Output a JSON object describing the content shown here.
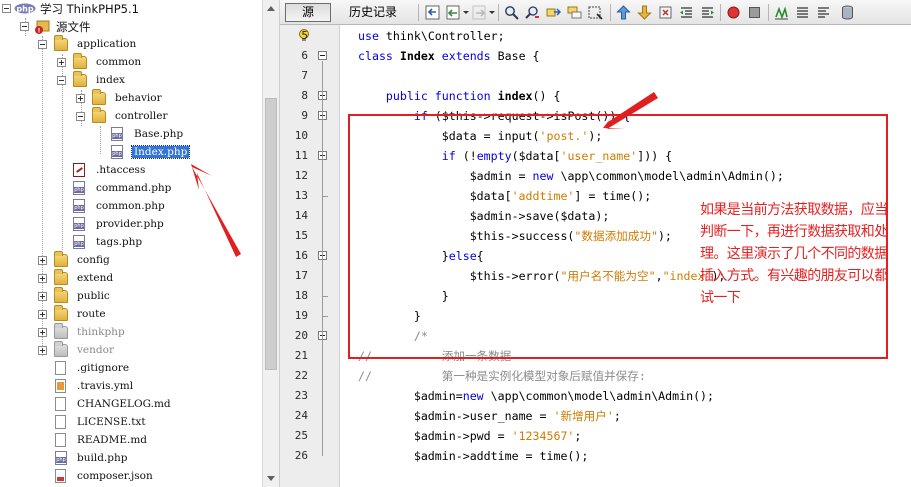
{
  "tree": {
    "root": "学习 ThinkPHP5.1",
    "source": "源文件",
    "items": {
      "application": "application",
      "common": "common",
      "index": "index",
      "behavior": "behavior",
      "controller": "controller",
      "base_php": "Base.php",
      "index_php": "Index.php",
      "htaccess": ".htaccess",
      "command_php": "command.php",
      "common_php": "common.php",
      "provider_php": "provider.php",
      "tags_php": "tags.php",
      "config": "config",
      "extend": "extend",
      "public": "public",
      "route": "route",
      "thinkphp": "thinkphp",
      "vendor": "vendor",
      "gitignore": ".gitignore",
      "travis": ".travis.yml",
      "changelog": "CHANGELOG.md",
      "license": "LICENSE.txt",
      "readme": "README.md",
      "build_php": "build.php",
      "composer_json": "composer.json"
    }
  },
  "editor": {
    "tab_source": "源",
    "tab_history": "历史记录",
    "lines": [
      {
        "n": "5",
        "code": "use think\\Controller;"
      },
      {
        "n": "6",
        "code": "class Index extends Base {"
      },
      {
        "n": "7",
        "code": ""
      },
      {
        "n": "8",
        "code": "    public function index() {"
      },
      {
        "n": "9",
        "code": "        if ($this->request->isPost()) {"
      },
      {
        "n": "10",
        "code": "            $data = input('post.');"
      },
      {
        "n": "11",
        "code": "            if (!empty($data['user_name'])) {"
      },
      {
        "n": "12",
        "code": "                $admin = new \\app\\common\\model\\admin\\Admin();"
      },
      {
        "n": "13",
        "code": "                $data['addtime'] = time();"
      },
      {
        "n": "14",
        "code": "                $admin->save($data);"
      },
      {
        "n": "15",
        "code": "                $this->success(\"数据添加成功\");"
      },
      {
        "n": "16",
        "code": "            }else{"
      },
      {
        "n": "17",
        "code": "                $this->error(\"用户名不能为空\",\"index\");"
      },
      {
        "n": "18",
        "code": "            }"
      },
      {
        "n": "19",
        "code": "        }"
      },
      {
        "n": "20",
        "code": "        /*"
      },
      {
        "n": "21",
        "code": "//          添加一条数据"
      },
      {
        "n": "22",
        "code": "//          第一种是实例化模型对象后赋值并保存:"
      },
      {
        "n": "23",
        "code": "        $admin=new \\app\\common\\model\\admin\\Admin();"
      },
      {
        "n": "24",
        "code": "        $admin->user_name = '新增用户';"
      },
      {
        "n": "25",
        "code": "        $admin->pwd = '1234567';"
      },
      {
        "n": "26",
        "code": "        $admin->addtime = time();"
      }
    ]
  },
  "annotation": {
    "note": "如果是当前方法获取数据，应当判断一下，再进行数据获取和处理。这里演示了几个不同的数据插入方式。有兴趣的朋友可以都试一下"
  },
  "colors": {
    "keyword": "#0000e6",
    "string": "#ce7b00",
    "comment": "#8c8c8c",
    "annotation": "#e02020",
    "selection": "#3474d6"
  }
}
